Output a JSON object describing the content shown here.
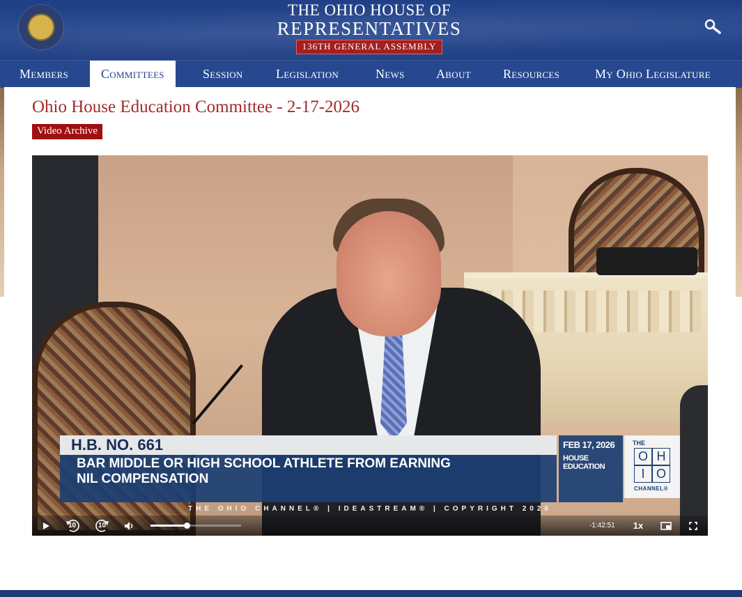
{
  "header": {
    "title_line1": "THE OHIO HOUSE OF",
    "title_line2": "REPRESENTATIVES",
    "assembly": "136TH GENERAL ASSEMBLY",
    "seal_icon": "state-seal-icon",
    "search_icon": "search-icon"
  },
  "nav": {
    "items": [
      {
        "label": "Members"
      },
      {
        "label": "Committees"
      },
      {
        "label": "Session"
      },
      {
        "label": "Legislation"
      },
      {
        "label": "News"
      },
      {
        "label": "About"
      },
      {
        "label": "Resources"
      },
      {
        "label": "My Ohio Legislature"
      }
    ],
    "active": "Committees"
  },
  "page": {
    "title": "Ohio House Education Committee - 2-17-2026",
    "badge": "Video Archive"
  },
  "video": {
    "lower_third": {
      "bill": "H.B. NO. 661",
      "description_line1": "BAR MIDDLE OR HIGH SCHOOL ATHLETE FROM EARNING",
      "description_line2": "NIL COMPENSATION",
      "date": "FEB 17, 2026",
      "committee_line1": "HOUSE",
      "committee_line2": "EDUCATION",
      "logo_the": "THE",
      "logo_letters": [
        "O",
        "H",
        "I",
        "O"
      ],
      "logo_channel": "CHANNEL®"
    },
    "credit": "THE OHIO CHANNEL® | IDEASTREAM® | COPYRIGHT 2026",
    "controls": {
      "play_icon": "play-icon",
      "rewind_label": "10",
      "forward_label": "10",
      "volume_icon": "volume-icon",
      "progress_fraction": 0.4,
      "time_remaining": "-1:42:51",
      "speed": "1x",
      "pip_icon": "picture-in-picture-icon",
      "fullscreen_icon": "fullscreen-icon"
    }
  },
  "colors": {
    "header_blue": "#27488f",
    "title_red": "#a52a2a",
    "badge_red": "#a01010",
    "assembly_red": "#a51f1f"
  }
}
